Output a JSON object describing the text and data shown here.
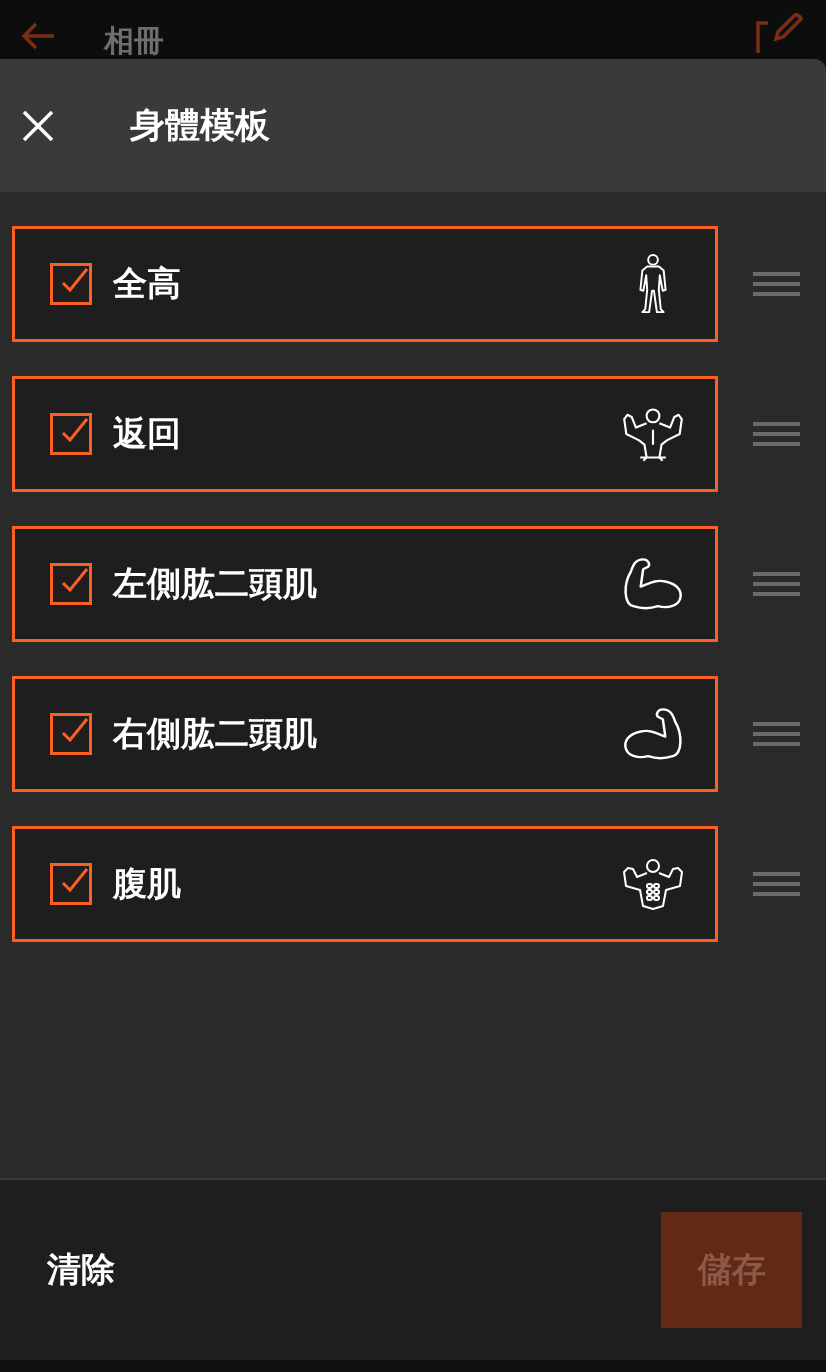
{
  "background_bar": {
    "title": "相冊"
  },
  "sheet": {
    "title": "身體模板"
  },
  "rows": [
    {
      "label": "全高",
      "checked": true
    },
    {
      "label": "返回",
      "checked": true
    },
    {
      "label": "左側肱二頭肌",
      "checked": true
    },
    {
      "label": "右側肱二頭肌",
      "checked": true
    },
    {
      "label": "腹肌",
      "checked": true
    }
  ],
  "footer": {
    "clear": "清除",
    "save": {
      "label": "儲存",
      "disabled": true
    }
  }
}
